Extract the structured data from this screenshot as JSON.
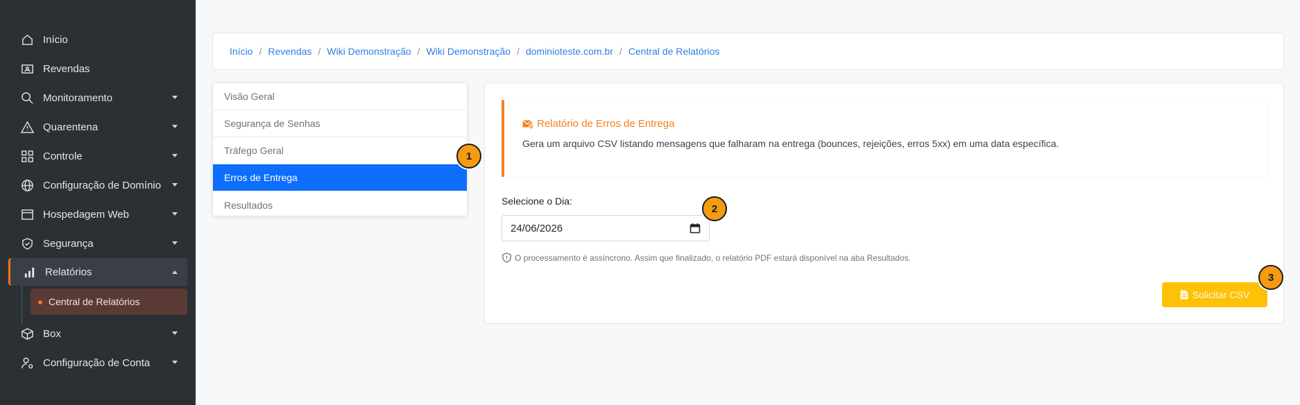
{
  "sidebar": {
    "items": [
      {
        "label": "Início",
        "icon": "home-icon"
      },
      {
        "label": "Revendas",
        "icon": "id-card-icon"
      },
      {
        "label": "Monitoramento",
        "icon": "search-icon"
      },
      {
        "label": "Quarentena",
        "icon": "warning-icon"
      },
      {
        "label": "Controle",
        "icon": "grid-icon"
      },
      {
        "label": "Configuração de Domínio",
        "icon": "globe-icon"
      },
      {
        "label": "Hospedagem Web",
        "icon": "browser-icon"
      },
      {
        "label": "Segurança",
        "icon": "shield-icon"
      },
      {
        "label": "Relatórios",
        "icon": "bar-chart-icon"
      },
      {
        "label": "Box",
        "icon": "box-icon"
      },
      {
        "label": "Configuração de Conta",
        "icon": "user-gear-icon"
      }
    ],
    "sub_item": "Central de Relatórios",
    "accent": "#f4731f"
  },
  "breadcrumb": [
    "Início",
    "Revendas",
    "Wiki Demonstração",
    "Wiki Demonstração",
    "dominioteste.com.br",
    "Central de Relatórios"
  ],
  "tabs": [
    "Visão Geral",
    "Segurança de Senhas",
    "Tráfego Geral",
    "Erros de Entrega",
    "Resultados"
  ],
  "notice": {
    "title": "Relatório de Erros de Entrega",
    "description": "Gera um arquivo CSV listando mensagens que falharam na entrega (bounces, rejeições, erros 5xx) em uma data específica."
  },
  "form": {
    "label": "Selecione o Dia:",
    "date_value": "24/06/2026",
    "hint": "O processamento é assíncrono. Assim que finalizado, o relatório PDF estará disponível na aba Resultados.",
    "button": "Solicitar CSV"
  },
  "markers": [
    "1",
    "2",
    "3"
  ],
  "colors": {
    "primary": "#0d6efd",
    "warning": "#ffc107",
    "orange": "#f4811f"
  }
}
